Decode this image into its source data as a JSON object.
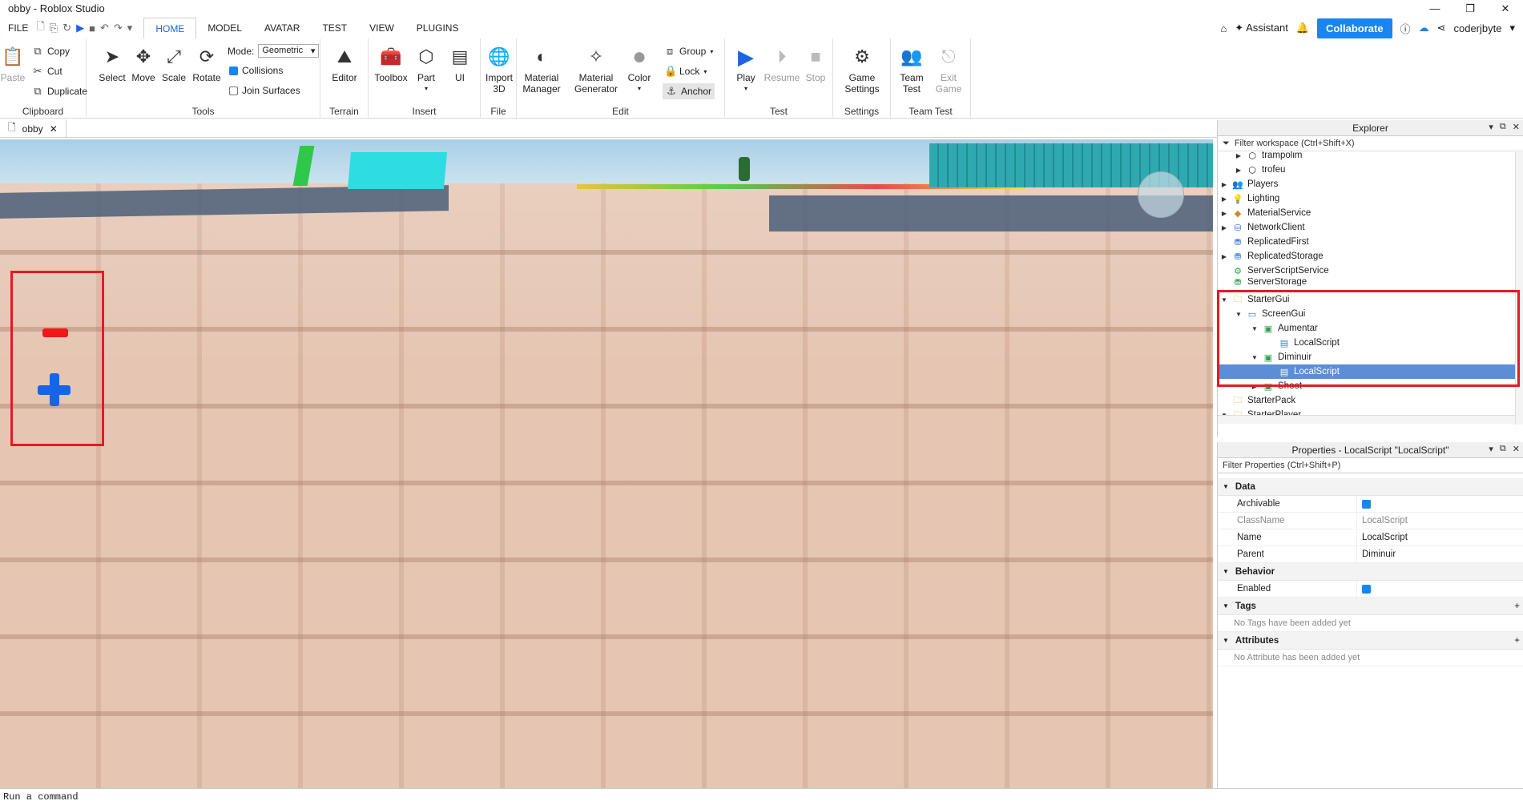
{
  "window": {
    "title": "obby - Roblox Studio",
    "controls": [
      "—",
      "❐",
      "✕"
    ]
  },
  "menu": {
    "file": "FILE",
    "tabs": [
      "HOME",
      "MODEL",
      "AVATAR",
      "TEST",
      "VIEW",
      "PLUGINS"
    ],
    "assistant": "Assistant",
    "collaborate": "Collaborate",
    "username": "coderjbyte"
  },
  "ribbon": {
    "clipboard": {
      "label": "Clipboard",
      "paste": "Paste",
      "copy": "Copy",
      "cut": "Cut",
      "duplicate": "Duplicate"
    },
    "tools": {
      "label": "Tools",
      "select": "Select",
      "move": "Move",
      "scale": "Scale",
      "rotate": "Rotate",
      "mode_label": "Mode:",
      "mode_value": "Geometric",
      "collisions": "Collisions",
      "join_surfaces": "Join Surfaces"
    },
    "terrain": {
      "label": "Terrain",
      "editor": "Editor"
    },
    "insert": {
      "label": "Insert",
      "toolbox": "Toolbox",
      "part": "Part",
      "ui": "UI"
    },
    "file": {
      "label": "File",
      "import3d_1": "Import",
      "import3d_2": "3D"
    },
    "edit": {
      "label": "Edit",
      "material_manager_1": "Material",
      "material_manager_2": "Manager",
      "material_generator_1": "Material",
      "material_generator_2": "Generator",
      "color": "Color",
      "group": "Group",
      "lock": "Lock",
      "anchor": "Anchor"
    },
    "test": {
      "label": "Test",
      "play": "Play",
      "resume": "Resume",
      "stop": "Stop"
    },
    "settings": {
      "label": "Settings",
      "game_settings_1": "Game",
      "game_settings_2": "Settings"
    },
    "team_test": {
      "label": "Team Test",
      "team_test_1": "Team",
      "team_test_2": "Test",
      "exit_game_1": "Exit",
      "exit_game_2": "Game"
    }
  },
  "doc_tab": {
    "name": "obby"
  },
  "command_bar": {
    "placeholder": "Run a command"
  },
  "explorer": {
    "title": "Explorer",
    "filter": "Filter workspace (Ctrl+Shift+X)",
    "items": [
      {
        "label": "trampolim",
        "icon": "model-icon"
      },
      {
        "label": "trofeu",
        "icon": "model-icon"
      },
      {
        "label": "Players",
        "icon": "players-icon"
      },
      {
        "label": "Lighting",
        "icon": "lighting-icon"
      },
      {
        "label": "MaterialService",
        "icon": "material-service-icon"
      },
      {
        "label": "NetworkClient",
        "icon": "network-icon"
      },
      {
        "label": "ReplicatedFirst",
        "icon": "replicated-first-icon"
      },
      {
        "label": "ReplicatedStorage",
        "icon": "replicated-storage-icon"
      },
      {
        "label": "ServerScriptService",
        "icon": "server-script-service-icon"
      },
      {
        "label": "ServerStorage",
        "icon": "server-storage-icon"
      },
      {
        "label": "StarterGui",
        "icon": "starter-gui-icon"
      },
      {
        "label": "ScreenGui",
        "icon": "screen-gui-icon"
      },
      {
        "label": "Aumentar",
        "icon": "text-button-icon"
      },
      {
        "label": "LocalScript",
        "icon": "local-script-icon"
      },
      {
        "label": "Diminuir",
        "icon": "text-button-icon"
      },
      {
        "label": "LocalScript",
        "icon": "local-script-icon"
      },
      {
        "label": "Shoot",
        "icon": "text-button-icon"
      },
      {
        "label": "StarterPack",
        "icon": "starter-pack-icon"
      },
      {
        "label": "StarterPlayer",
        "icon": "starter-player-icon"
      }
    ]
  },
  "properties": {
    "title": "Properties - LocalScript \"LocalScript\"",
    "filter": "Filter Properties (Ctrl+Shift+P)",
    "data_section": "Data",
    "archivable": "Archivable",
    "classname_key": "ClassName",
    "classname_val": "LocalScript",
    "name_key": "Name",
    "name_val": "LocalScript",
    "parent_key": "Parent",
    "parent_val": "Diminuir",
    "behavior_section": "Behavior",
    "enabled": "Enabled",
    "tags_section": "Tags",
    "tags_note": "No Tags have been added yet",
    "attributes_section": "Attributes",
    "attributes_note": "No Attribute has been added yet"
  },
  "colors": {
    "accent": "#1a84f0",
    "highlight": "#e31b23",
    "selection": "#5b8ed6",
    "minus_button": "#f01818",
    "plus_button": "#1764e6"
  }
}
